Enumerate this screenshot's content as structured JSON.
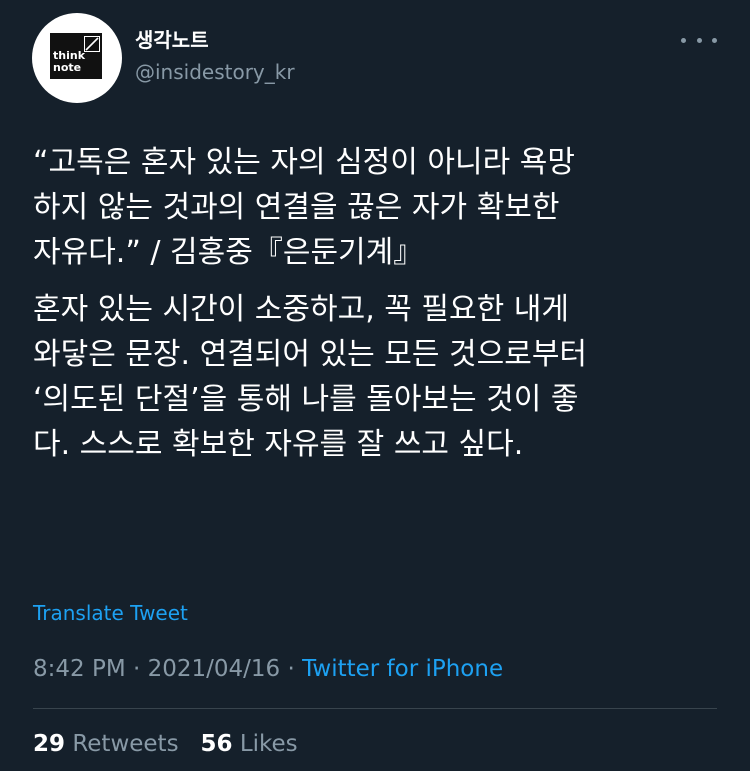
{
  "author": {
    "display_name": "생각노트",
    "handle": "@insidestory_kr",
    "avatar": {
      "logo_line1": "think",
      "logo_line2": "note",
      "background": "#ffffff",
      "box_color": "#111111"
    }
  },
  "tweet": {
    "paragraph1": "“고독은 혼자 있는 자의 심정이 아니라 욕망\n하지 않는 것과의 연결을 끊은 자가 확보한\n자유다.” / 김홍중『은둔기계』",
    "paragraph2": "혼자 있는 시간이 소중하고, 꼭 필요한 내게\n와닿은 문장. 연결되어 있는 모든 것으로부터\n‘의도된 단절’을 통해 나를 돌아보는 것이 좋\n다. 스스로 확보한 자유를 잘 쓰고 싶다."
  },
  "translate_label": "Translate Tweet",
  "meta": {
    "time": "8:42 PM",
    "separator": " · ",
    "date": "2021/04/16",
    "source": "Twitter for iPhone"
  },
  "stats": {
    "retweets_count": "29",
    "retweets_label": "Retweets",
    "likes_count": "56",
    "likes_label": "Likes"
  },
  "icons": {
    "more": "more-horizontal-icon"
  },
  "colors": {
    "background": "#15202b",
    "text": "#ffffff",
    "secondary": "#8899a6",
    "accent": "#1da1f2",
    "divider": "#38444d"
  }
}
